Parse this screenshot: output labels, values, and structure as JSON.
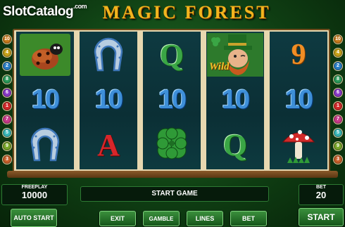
{
  "watermark": {
    "text": "SlotCatalog",
    "sup": ".com"
  },
  "game": {
    "title": "MAGIC FOREST"
  },
  "paylines": {
    "left": [
      "10",
      "4",
      "2",
      "8",
      "6",
      "1",
      "7",
      "5",
      "9",
      "3"
    ],
    "right": [
      "10",
      "4",
      "2",
      "8",
      "6",
      "1",
      "7",
      "5",
      "9",
      "3"
    ]
  },
  "reels": [
    {
      "symbols": [
        "ladybug",
        "10",
        "horseshoe"
      ]
    },
    {
      "symbols": [
        "horseshoe",
        "10",
        "A"
      ]
    },
    {
      "symbols": [
        "Q",
        "10",
        "clover"
      ]
    },
    {
      "symbols": [
        "leprechaun-wild",
        "10",
        "Q"
      ]
    },
    {
      "symbols": [
        "9",
        "10",
        "mushroom"
      ]
    }
  ],
  "symbol_text": {
    "wild": "Wild"
  },
  "freeplay": {
    "label": "FREEPLAY",
    "value": "10000"
  },
  "message": "START GAME",
  "bet": {
    "label": "BET",
    "value": "20"
  },
  "buttons": {
    "auto_start": "AUTO START",
    "exit": "EXIT",
    "gamble": "GAMBLE",
    "lines": "LINES",
    "bet": "BET",
    "start": "START"
  }
}
